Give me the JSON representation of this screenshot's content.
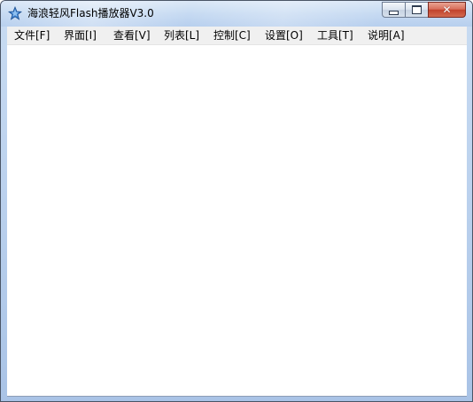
{
  "window": {
    "title": "海浪轻风Flash播放器V3.0",
    "app_icon": "blue-star-icon",
    "caption": {
      "minimize_icon": "minimize-icon",
      "maximize_icon": "maximize-icon",
      "close_icon": "close-icon",
      "close_glyph": "✕"
    }
  },
  "menu": {
    "items": [
      {
        "label": "文件[F]"
      },
      {
        "label": "界面[I]"
      },
      {
        "label": "查看[V]"
      },
      {
        "label": "列表[L]"
      },
      {
        "label": "控制[C]"
      },
      {
        "label": "设置[O]"
      },
      {
        "label": "工具[T]"
      },
      {
        "label": "说明[A]"
      }
    ]
  },
  "colors": {
    "accent_close": "#c2432c",
    "frame": "#bcd2ee",
    "menubar": "#f0f0f0"
  }
}
